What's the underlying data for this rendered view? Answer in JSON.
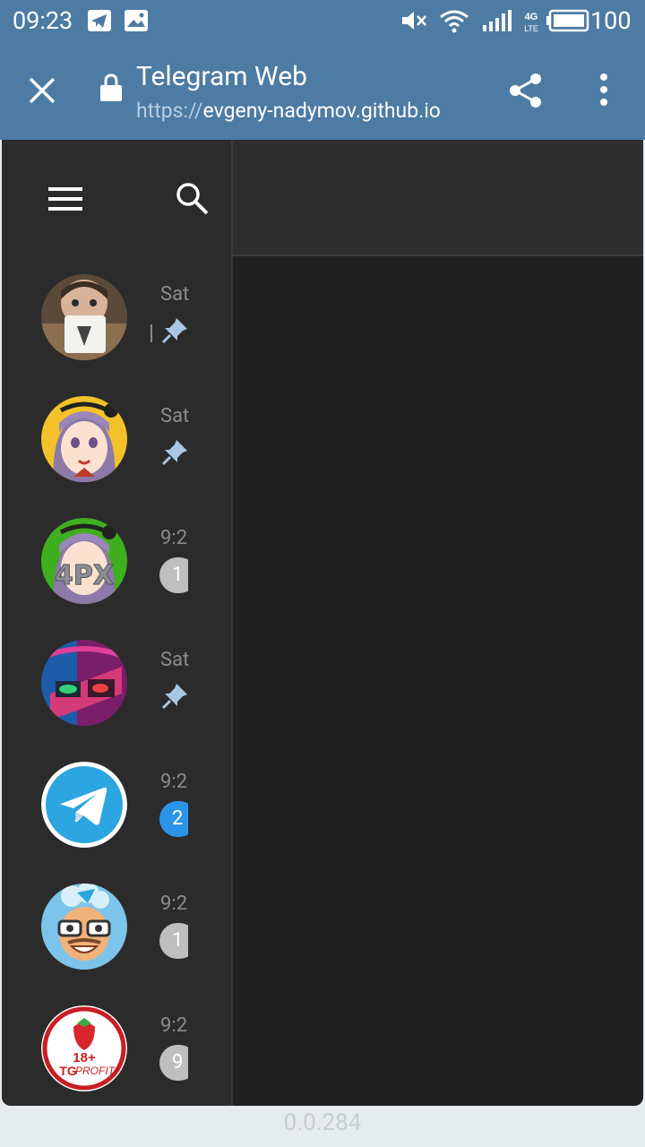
{
  "status_bar": {
    "time": "09:23",
    "battery": "100",
    "icons": [
      "telegram-notification-icon",
      "image-notification-icon",
      "mute-icon",
      "wifi-icon",
      "signal-icon",
      "4g-lte-icon",
      "battery-icon"
    ]
  },
  "browser": {
    "title": "Telegram Web",
    "url_scheme": "https://",
    "url_host": "evgeny-nadymov.github.io",
    "icons": [
      "close-icon",
      "lock-icon",
      "share-icon",
      "more-icon"
    ]
  },
  "sidebar": {
    "icons": [
      "menu-icon",
      "search-icon"
    ],
    "chats": [
      {
        "time": "Sat",
        "indicator": "pin"
      },
      {
        "time": "Sat",
        "indicator": "pin"
      },
      {
        "time": "9:2",
        "indicator": "badge",
        "badge": "1",
        "badge_color": "#bfbfbf"
      },
      {
        "time": "Sat",
        "indicator": "pin"
      },
      {
        "time": "9:2",
        "indicator": "badge",
        "badge": "2",
        "badge_color": "#2c94e8"
      },
      {
        "time": "9:2",
        "indicator": "badge",
        "badge": "1",
        "badge_color": "#bfbfbf"
      },
      {
        "time": "9:2",
        "indicator": "badge",
        "badge": "9",
        "badge_color": "#bfbfbf"
      }
    ],
    "avatar_texts": {
      "chat3": "4PX",
      "chat7_line1": "18+",
      "chat7_line2": "TG",
      "chat7_line3": "PROFIT"
    }
  },
  "footer": {
    "version": "0.0.284"
  },
  "colors": {
    "header": "#4d7ba3",
    "sidebar": "#2b2b2b",
    "chat_background": "#212121",
    "unread_badge": "#2c94e8",
    "muted_badge": "#bfbfbf"
  }
}
